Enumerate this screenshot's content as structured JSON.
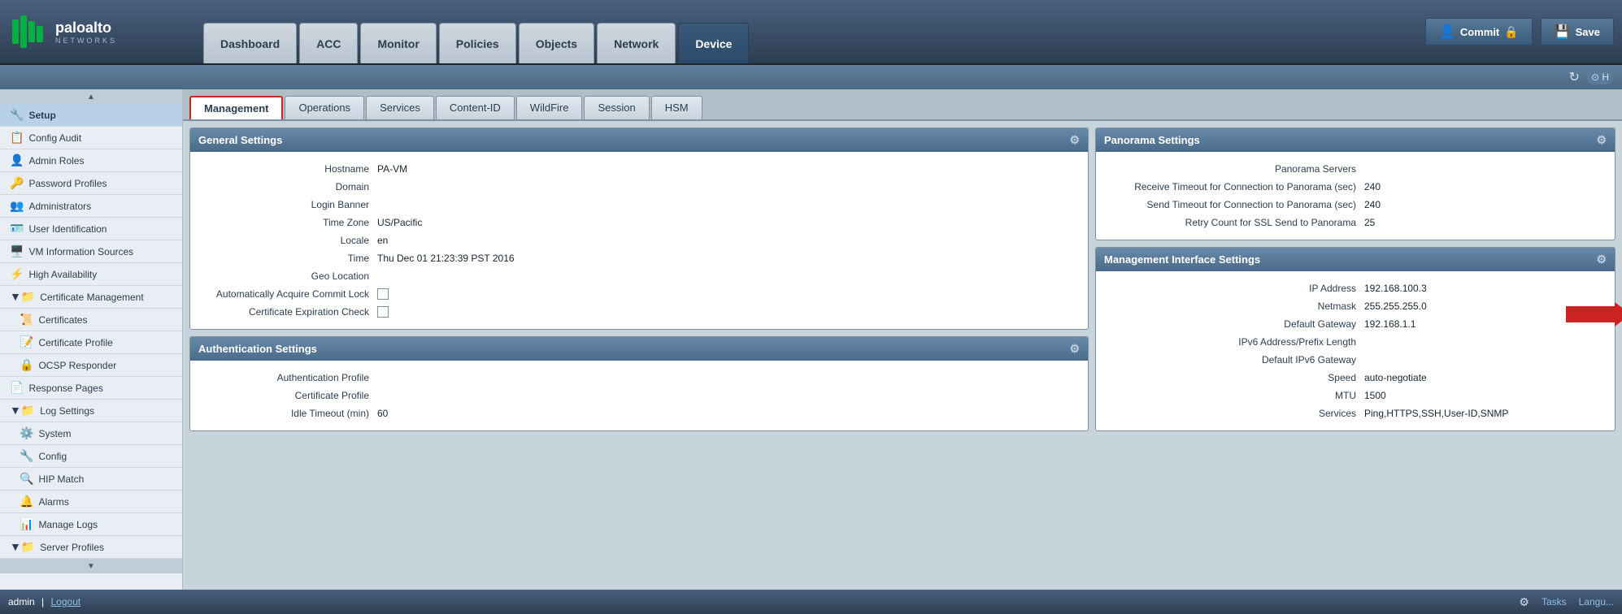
{
  "app": {
    "title": "Palo Alto Networks",
    "logo_sub": "NETWORKS"
  },
  "nav": {
    "tabs": [
      {
        "label": "Dashboard",
        "active": false
      },
      {
        "label": "ACC",
        "active": false
      },
      {
        "label": "Monitor",
        "active": false
      },
      {
        "label": "Policies",
        "active": false
      },
      {
        "label": "Objects",
        "active": false
      },
      {
        "label": "Network",
        "active": false
      },
      {
        "label": "Device",
        "active": true
      }
    ],
    "commit_label": "Commit",
    "save_label": "Save"
  },
  "sidebar": {
    "items": [
      {
        "label": "Setup",
        "indent": 0,
        "active": true,
        "icon": "🔧"
      },
      {
        "label": "Config Audit",
        "indent": 0,
        "active": false,
        "icon": "📋"
      },
      {
        "label": "Admin Roles",
        "indent": 0,
        "active": false,
        "icon": "👤"
      },
      {
        "label": "Password Profiles",
        "indent": 0,
        "active": false,
        "icon": "🔑"
      },
      {
        "label": "Administrators",
        "indent": 0,
        "active": false,
        "icon": "👥"
      },
      {
        "label": "User Identification",
        "indent": 0,
        "active": false,
        "icon": "🪪"
      },
      {
        "label": "VM Information Sources",
        "indent": 0,
        "active": false,
        "icon": "🖥️"
      },
      {
        "label": "High Availability",
        "indent": 0,
        "active": false,
        "icon": "⚡"
      },
      {
        "label": "Certificate Management",
        "indent": 0,
        "active": false,
        "icon": "📁",
        "expanded": true
      },
      {
        "label": "Certificates",
        "indent": 1,
        "active": false,
        "icon": "📜"
      },
      {
        "label": "Certificate Profile",
        "indent": 1,
        "active": false,
        "icon": "📝"
      },
      {
        "label": "OCSP Responder",
        "indent": 1,
        "active": false,
        "icon": "🔒"
      },
      {
        "label": "Response Pages",
        "indent": 0,
        "active": false,
        "icon": "📄"
      },
      {
        "label": "Log Settings",
        "indent": 0,
        "active": false,
        "icon": "📁",
        "expanded": true
      },
      {
        "label": "System",
        "indent": 1,
        "active": false,
        "icon": "⚙️"
      },
      {
        "label": "Config",
        "indent": 1,
        "active": false,
        "icon": "🔧"
      },
      {
        "label": "HIP Match",
        "indent": 1,
        "active": false,
        "icon": "🔍"
      },
      {
        "label": "Alarms",
        "indent": 1,
        "active": false,
        "icon": "🔔"
      },
      {
        "label": "Manage Logs",
        "indent": 1,
        "active": false,
        "icon": "📊"
      },
      {
        "label": "Server Profiles",
        "indent": 0,
        "active": false,
        "icon": "📁"
      }
    ]
  },
  "sub_tabs": {
    "tabs": [
      {
        "label": "Management",
        "active": true
      },
      {
        "label": "Operations",
        "active": false
      },
      {
        "label": "Services",
        "active": false
      },
      {
        "label": "Content-ID",
        "active": false
      },
      {
        "label": "WildFire",
        "active": false
      },
      {
        "label": "Session",
        "active": false
      },
      {
        "label": "HSM",
        "active": false
      }
    ]
  },
  "general_settings": {
    "title": "General Settings",
    "hostname_label": "Hostname",
    "hostname_value": "PA-VM",
    "domain_label": "Domain",
    "domain_value": "",
    "login_banner_label": "Login Banner",
    "login_banner_value": "",
    "timezone_label": "Time Zone",
    "timezone_value": "US/Pacific",
    "locale_label": "Locale",
    "locale_value": "en",
    "time_label": "Time",
    "time_value": "Thu Dec 01 21:23:39 PST 2016",
    "geo_location_label": "Geo Location",
    "geo_location_value": "",
    "auto_commit_lock_label": "Automatically Acquire Commit Lock",
    "cert_expiration_label": "Certificate Expiration Check"
  },
  "panorama_settings": {
    "title": "Panorama Settings",
    "servers_label": "Panorama Servers",
    "servers_value": "",
    "receive_timeout_label": "Receive Timeout for Connection to Panorama (sec)",
    "receive_timeout_value": "240",
    "send_timeout_label": "Send Timeout for Connection to Panorama (sec)",
    "send_timeout_value": "240",
    "retry_count_label": "Retry Count for SSL Send to Panorama",
    "retry_count_value": "25"
  },
  "auth_settings": {
    "title": "Authentication Settings",
    "auth_profile_label": "Authentication Profile",
    "auth_profile_value": "",
    "cert_profile_label": "Certificate Profile",
    "cert_profile_value": "",
    "idle_timeout_label": "Idle Timeout (min)",
    "idle_timeout_value": "60"
  },
  "mgmt_interface": {
    "title": "Management Interface Settings",
    "ip_address_label": "IP Address",
    "ip_address_value": "192.168.100.3",
    "netmask_label": "Netmask",
    "netmask_value": "255.255.255.0",
    "default_gateway_label": "Default Gateway",
    "default_gateway_value": "192.168.1.1",
    "ipv6_label": "IPv6 Address/Prefix Length",
    "ipv6_value": "",
    "default_ipv6_gw_label": "Default IPv6 Gateway",
    "default_ipv6_gw_value": "",
    "speed_label": "Speed",
    "speed_value": "auto-negotiate",
    "mtu_label": "MTU",
    "mtu_value": "1500",
    "services_label": "Services",
    "services_value": "Ping,HTTPS,SSH,User-ID,SNMP"
  },
  "bottom_bar": {
    "user": "admin",
    "separator": "|",
    "logout": "Logout",
    "tasks": "Tasks",
    "language": "Langu..."
  }
}
